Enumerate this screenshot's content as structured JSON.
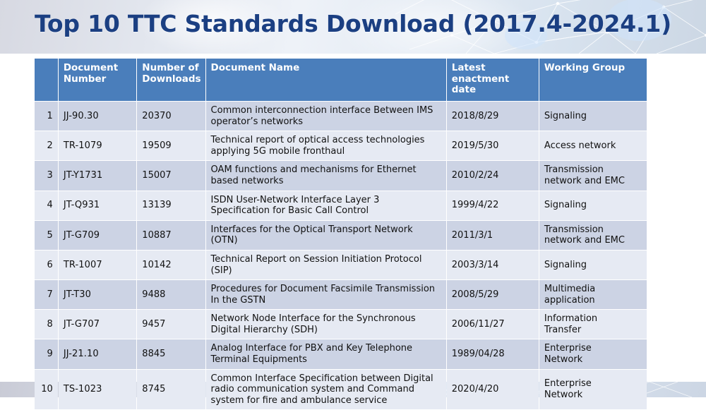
{
  "title": "Top 10 TTC Standards Download (2017.4-2024.1)",
  "table": {
    "headers": {
      "index": "",
      "document_number": "Document\nNumber",
      "number_of_downloads": "Number of\nDownloads",
      "document_name": "Document Name",
      "latest_enactment_date": "Latest\nenactment date",
      "working_group": "Working  Group"
    },
    "rows": [
      {
        "index": "1",
        "document_number": "JJ-90.30",
        "downloads": "20370",
        "document_name": "Common interconnection interface Between IMS\noperator’s networks",
        "date": "2018/8/29",
        "working_group": "Signaling"
      },
      {
        "index": "2",
        "document_number": "TR-1079",
        "downloads": "19509",
        "document_name": "Technical report of optical access technologies\napplying 5G mobile fronthaul",
        "date": "2019/5/30",
        "working_group": "Access network"
      },
      {
        "index": "3",
        "document_number": "JT-Y1731",
        "downloads": "15007",
        "document_name": "OAM functions and mechanisms for Ethernet\nbased networks",
        "date": "2010/2/24",
        "working_group": "Transmission\nnetwork and EMC"
      },
      {
        "index": "4",
        "document_number": "JT-Q931",
        "downloads": "13139",
        "document_name": "ISDN  User-Network Interface Layer 3\nSpecification for Basic Call Control",
        "date": "1999/4/22",
        "working_group": "Signaling"
      },
      {
        "index": "5",
        "document_number": "JT-G709",
        "downloads": "10887",
        "document_name": "Interfaces for the Optical Transport Network\n(OTN)",
        "date": "2011/3/1",
        "working_group": "Transmission\nnetwork and EMC"
      },
      {
        "index": "6",
        "document_number": "TR-1007",
        "downloads": "10142",
        "document_name": "Technical Report on Session Initiation Protocol\n(SIP)",
        "date": "2003/3/14",
        "working_group": "Signaling"
      },
      {
        "index": "7",
        "document_number": "JT-T30",
        "downloads": "9488",
        "document_name": "Procedures for Document Facsimile Transmission\nIn the GSTN",
        "date": "2008/5/29",
        "working_group": "Multimedia\napplication"
      },
      {
        "index": "8",
        "document_number": "JT-G707",
        "downloads": "9457",
        "document_name": "Network Node Interface for the Synchronous\nDigital Hierarchy (SDH)",
        "date": "2006/11/27",
        "working_group": "Information\nTransfer"
      },
      {
        "index": "9",
        "document_number": "JJ-21.10",
        "downloads": "8845",
        "document_name": "Analog Interface for PBX and Key Telephone\nTerminal Equipments",
        "date": "1989/04/28",
        "working_group": "Enterprise\nNetwork"
      },
      {
        "index": "10",
        "document_number": "TS-1023",
        "downloads": "8745",
        "document_name": "Common Interface Specification between Digital\nradio communication system and Command\nsystem for fire and ambulance service",
        "date": "2020/4/20",
        "working_group": "Enterprise\nNetwork"
      }
    ]
  },
  "colors": {
    "header_fill": "#4a7ebb",
    "row_band_dark": "#ccd3e4",
    "row_band_light": "#e6eaf3",
    "title_text": "#1b3f82"
  }
}
